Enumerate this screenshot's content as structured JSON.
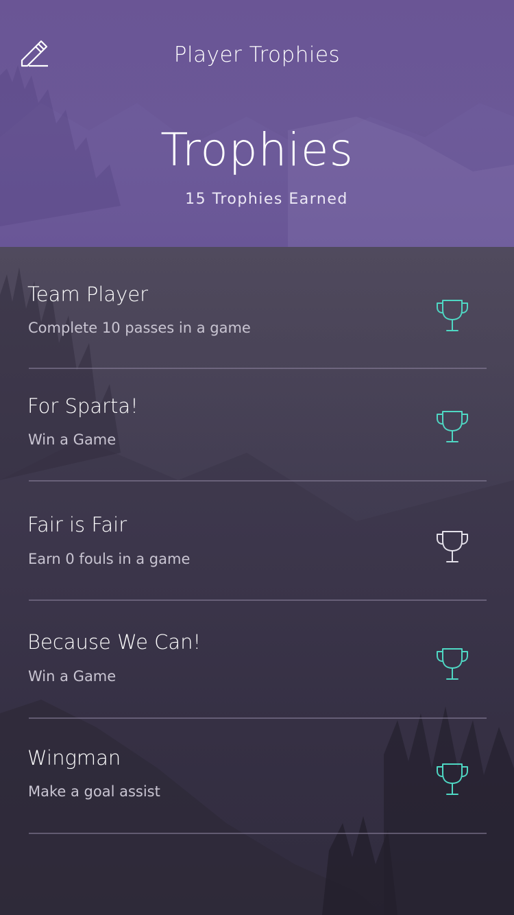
{
  "header": {
    "nav_title": "Player Trophies",
    "title": "Trophies",
    "subtitle": "15 Trophies Earned",
    "edit_icon": "pencil-edit-icon"
  },
  "colors": {
    "header_purple": "#6a5595",
    "trophy_earned": "#4fd8c4",
    "trophy_locked": "#e4e1ea",
    "divider": "#8c849e"
  },
  "trophies": [
    {
      "title": "Team Player",
      "description": "Complete 10 passes in a game",
      "earned": true,
      "icon": "trophy-icon"
    },
    {
      "title": "For Sparta!",
      "description": "Win a Game",
      "earned": true,
      "icon": "trophy-icon"
    },
    {
      "title": "Fair is Fair",
      "description": "Earn 0 fouls in a game",
      "earned": false,
      "icon": "trophy-icon"
    },
    {
      "title": "Because We Can!",
      "description": "Win a Game",
      "earned": true,
      "icon": "trophy-icon"
    },
    {
      "title": "Wingman",
      "description": "Make a goal assist",
      "earned": true,
      "icon": "trophy-icon"
    }
  ]
}
